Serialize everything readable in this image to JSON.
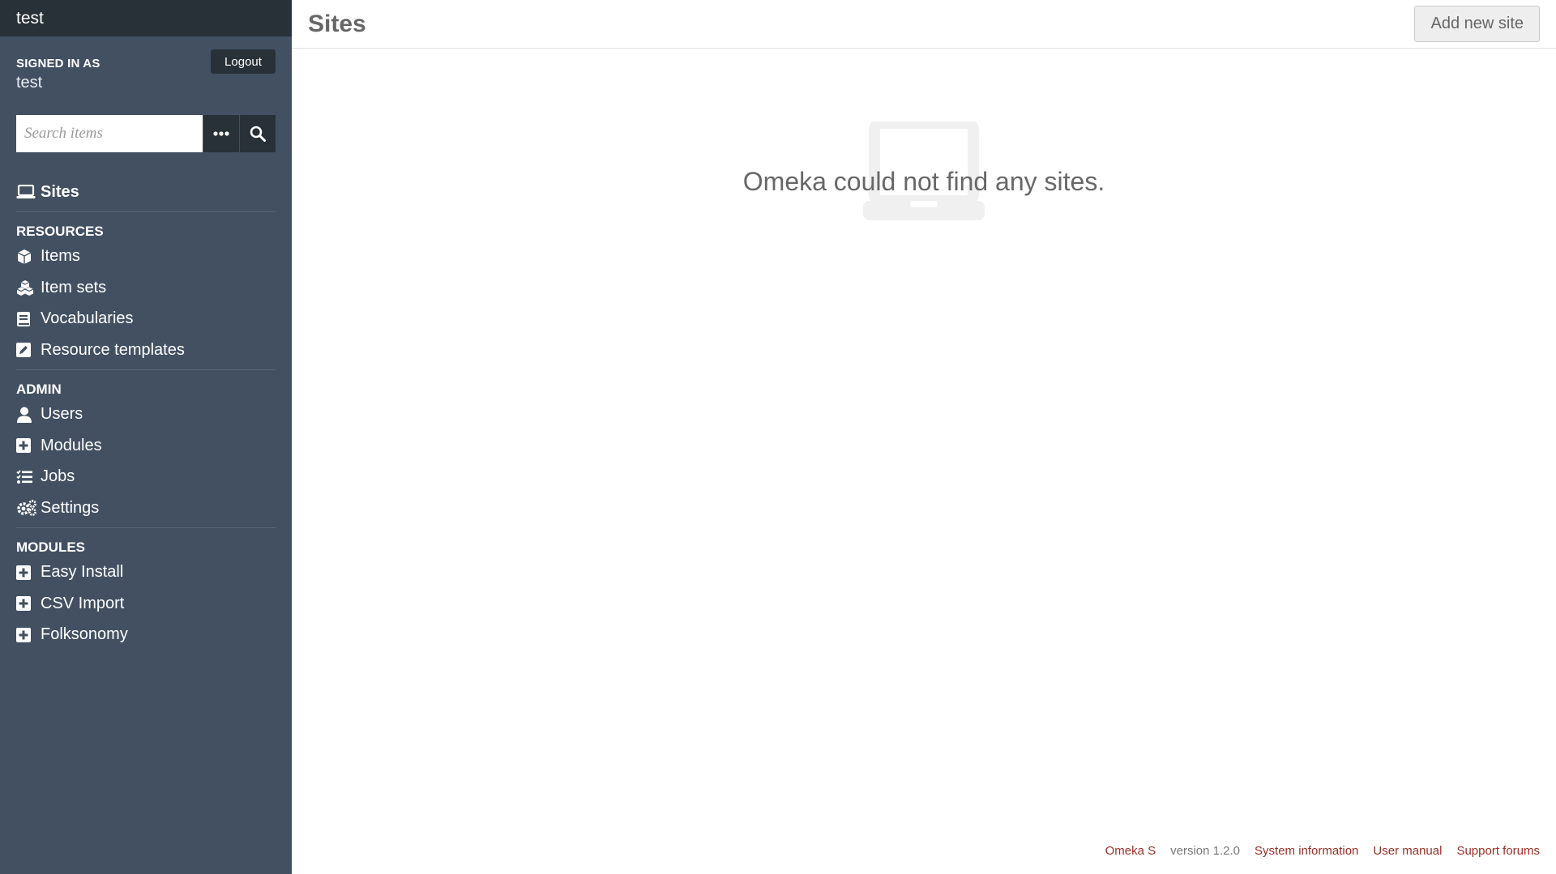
{
  "sidebar": {
    "site_name": "test",
    "signed_in_label": "Signed in as",
    "signed_in_user": "test",
    "logout_label": "Logout",
    "search": {
      "placeholder": "Search items",
      "options_icon": "ellipsis-icon",
      "submit_icon": "search-icon"
    },
    "nav": {
      "sites": {
        "label": "Sites",
        "icon": "laptop-icon"
      },
      "resources_heading": "Resources",
      "resources": [
        {
          "label": "Items",
          "icon": "cube-icon"
        },
        {
          "label": "Item sets",
          "icon": "cubes-icon"
        },
        {
          "label": "Vocabularies",
          "icon": "book-icon"
        },
        {
          "label": "Resource templates",
          "icon": "edit-icon"
        }
      ],
      "admin_heading": "Admin",
      "admin": [
        {
          "label": "Users",
          "icon": "user-icon"
        },
        {
          "label": "Modules",
          "icon": "plus-square-icon"
        },
        {
          "label": "Jobs",
          "icon": "tasks-icon"
        },
        {
          "label": "Settings",
          "icon": "cogs-icon"
        }
      ],
      "modules_heading": "Modules",
      "modules": [
        {
          "label": "Easy Install",
          "icon": "plus-square-icon"
        },
        {
          "label": "CSV Import",
          "icon": "plus-square-icon"
        },
        {
          "label": "Folksonomy",
          "icon": "plus-square-icon"
        }
      ]
    }
  },
  "main": {
    "title": "Sites",
    "add_button": "Add new site",
    "empty_message": "Omeka could not find any sites.",
    "empty_icon": "laptop-icon"
  },
  "footer": {
    "product": "Omeka S",
    "version": "version 1.2.0",
    "links": [
      "System information",
      "User manual",
      "Support forums"
    ]
  },
  "colors": {
    "sidebar_bg": "#425062",
    "sidebar_dark": "#283138",
    "footer_link": "#9b2f24"
  }
}
